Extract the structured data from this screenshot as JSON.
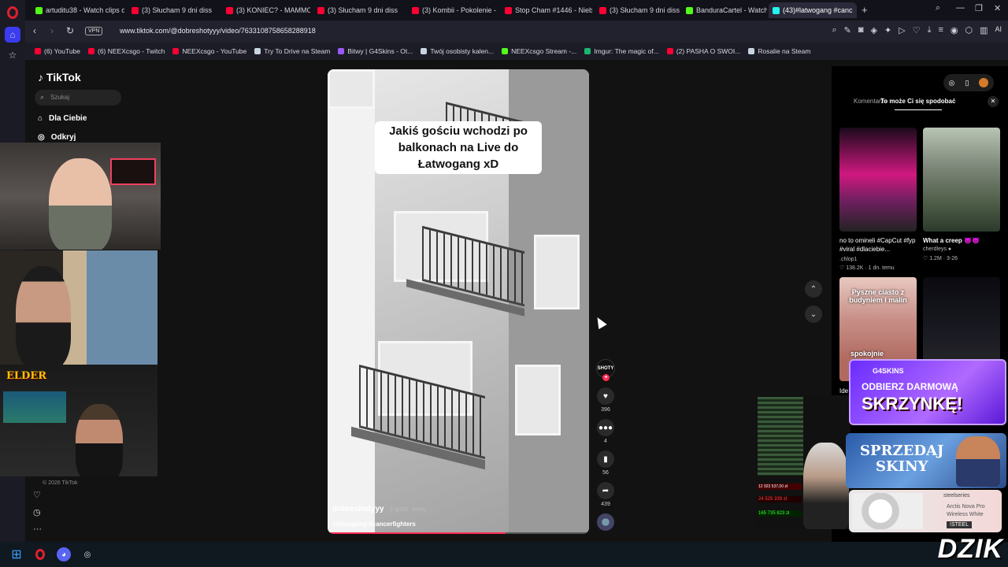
{
  "tabs": [
    {
      "label": "artuditu38 - Watch clips o",
      "color": "#53fc18"
    },
    {
      "label": "(3) Słucham 9 dni diss",
      "color": "#ff0033"
    },
    {
      "label": "(3) KONIEC? - MAMMON",
      "color": "#ff0033"
    },
    {
      "label": "(3) Słucham 9 dni diss",
      "color": "#ff0033"
    },
    {
      "label": "(3) Kombii - Pokolenie - Yo",
      "color": "#ff0033"
    },
    {
      "label": "Stop Cham #1446 - Niebe",
      "color": "#ff0033"
    },
    {
      "label": "(3) Słucham 9 dni diss",
      "color": "#ff0033"
    },
    {
      "label": "BanduraCartel - Watch th",
      "color": "#53fc18"
    },
    {
      "label": "(43)#latwogang #canc",
      "color": "#25f4ee"
    }
  ],
  "address": {
    "vpn": "VPN",
    "url": "www.tiktok.com/@dobreshotyyy/video/7633108758658288918",
    "ai": "AI"
  },
  "bookmarks": [
    {
      "label": "(6) YouTube",
      "color": "#ff0033"
    },
    {
      "label": "(6) NEEXcsgo - Twitch",
      "color": "#ff0033"
    },
    {
      "label": "NEEXcsgo - YouTube",
      "color": "#ff0033"
    },
    {
      "label": "Try To Drive na Steam",
      "color": "#c7d5e0"
    },
    {
      "label": "Bitwy | G4Skins - Ot...",
      "color": "#9b59ff"
    },
    {
      "label": "Twój osobisty kalen...",
      "color": "#c7d5e0"
    },
    {
      "label": "NEEXcsgo Stream -...",
      "color": "#53fc18"
    },
    {
      "label": "Imgur: The magic of...",
      "color": "#1bb76e"
    },
    {
      "label": "(2) PASHA O SWOI...",
      "color": "#ff0033"
    },
    {
      "label": "Rosalie na Steam",
      "color": "#c7d5e0"
    }
  ],
  "tiktok": {
    "logo": "TikTok",
    "search_placeholder": "Szukaj",
    "nav": [
      "Dla Ciebie",
      "Odkryj"
    ],
    "copyright": "© 2026 TikTok"
  },
  "video": {
    "caption": "Jakiś gościu wchodzi po balkonach na Live do Łatwogang xD",
    "author": "dobreshotyyy",
    "time": " · 1 godz. temu",
    "tags": "#latwogang #cancerfighters",
    "progress": 0.68,
    "avatar_text": "SHOTY",
    "likes": "396",
    "comments": "4",
    "saves": "56",
    "shares": "439"
  },
  "right_panel": {
    "tab_comments": "Komentarze",
    "tab_suggest": "To może Ci się spodobać",
    "items": [
      {
        "caption": "no to omineli #CapCut #fyp #viral #dlaciebie...",
        "author": ".chlop1",
        "meta": "♡ 138.2K · 1 dn. temu"
      },
      {
        "caption": "What a creep 😈😈",
        "author": "cherdleys ●",
        "meta": "♡ 1.2M · 3-26"
      },
      {
        "caption": "Pyszne ciasto z budyniem i malin",
        "overlay2": "spokojnie",
        "author": "",
        "meta": ""
      },
      {
        "caption": "",
        "author": "",
        "meta": ""
      }
    ],
    "partial_label": "Ide"
  },
  "overlays": {
    "elder": "ELDER",
    "ad1_brand": "G4SKINS",
    "ad1_line1": "ODBIERZ DARMOWĄ",
    "ad1_line2": "SKRZYNKĘ!",
    "ad2_line1": "SPRZEDAJ",
    "ad2_line2": "SKINY",
    "ad3_brand": "steelseries",
    "ad3_line1": "Arctis Nova Pro",
    "ad3_line2": "Wireless White",
    "ad3_code": "!STEEL",
    "stream_val1": "12 923 537,00 zł",
    "stream_val2": "24 525 339 zł",
    "stream_val3": "165 735 823 zł",
    "dzik": "DZIK"
  }
}
